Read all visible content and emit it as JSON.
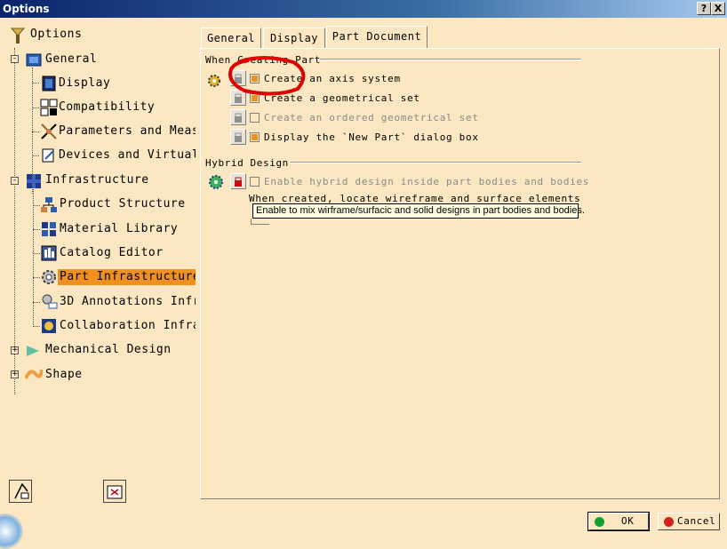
{
  "window": {
    "title": "Options",
    "help_label": "?",
    "close_label": "X"
  },
  "tree": {
    "items": [
      {
        "label": "Options"
      },
      {
        "label": "General"
      },
      {
        "label": "Display"
      },
      {
        "label": "Compatibility"
      },
      {
        "label": "Parameters and Meas"
      },
      {
        "label": "Devices and Virtual"
      },
      {
        "label": "Infrastructure"
      },
      {
        "label": "Product Structure"
      },
      {
        "label": "Material Library"
      },
      {
        "label": "Catalog Editor"
      },
      {
        "label": "Part Infrastructure",
        "selected": true
      },
      {
        "label": "3D Annotations Infr"
      },
      {
        "label": "Collaboration Infra"
      },
      {
        "label": "Mechanical Design"
      },
      {
        "label": "Shape"
      }
    ],
    "expander_symbol": "-",
    "collapsed_symbol": "+"
  },
  "tabs": [
    {
      "label": "General"
    },
    {
      "label": "Display"
    },
    {
      "label": "Part Document",
      "active": true
    }
  ],
  "sections": {
    "when_creating": {
      "title": "When Creating Part",
      "options": [
        {
          "label": "Create an axis system",
          "checked": true,
          "enabled": true
        },
        {
          "label": "Create a geometrical set",
          "checked": true,
          "enabled": true
        },
        {
          "label": "Create an ordered geometrical set",
          "checked": false,
          "enabled": false
        },
        {
          "label": "Display the `New Part` dialog box",
          "checked": true,
          "enabled": true
        }
      ]
    },
    "hybrid": {
      "title": "Hybrid Design",
      "option": {
        "label": "Enable hybrid design inside part bodies and bodies",
        "checked": false,
        "enabled": false
      },
      "note": "When created, locate wireframe and surface elements"
    }
  },
  "tooltip": "Enable to mix wirframe/surfacic and solid designs in part bodies and bodies.",
  "buttons": {
    "ok": "OK",
    "cancel": "Cancel"
  },
  "colors": {
    "accent": "#f0901e",
    "background": "#fbe8c2",
    "title_bar": "#0a246a",
    "annotation": "#e00000"
  }
}
